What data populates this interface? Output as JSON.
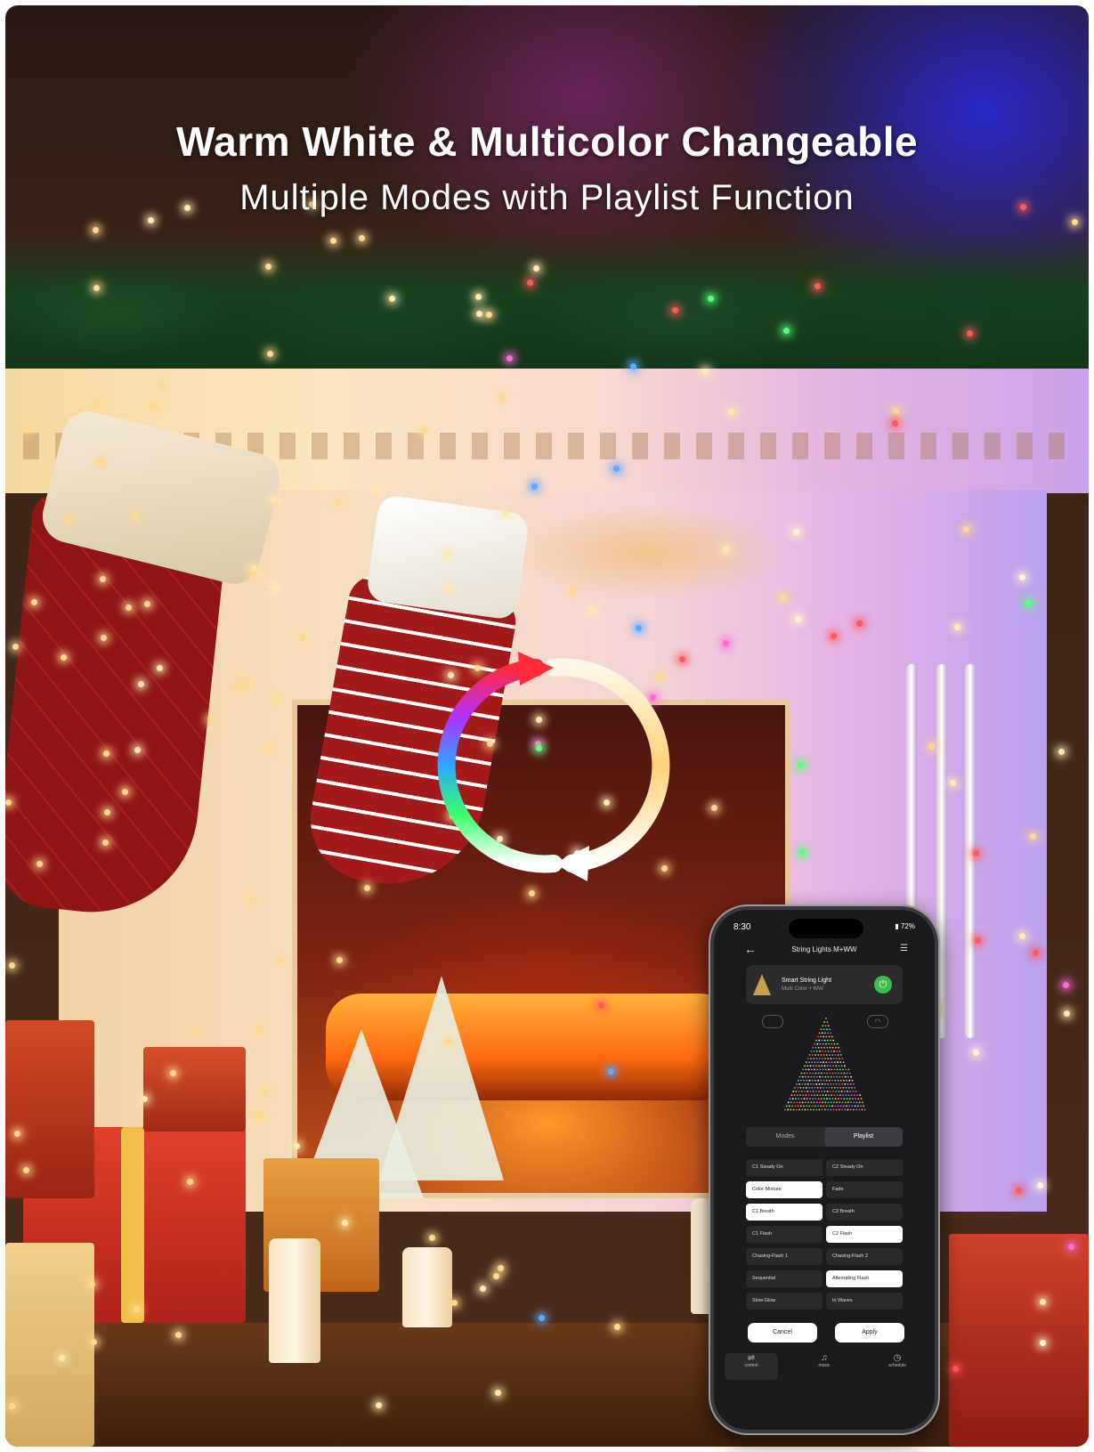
{
  "headline": "Warm White & Multicolor Changeable",
  "subheadline": "Multiple Modes with Playlist Function",
  "phone": {
    "status_time": "8:30",
    "battery": "72%",
    "nav_title": "String Lights M+WW",
    "device": {
      "name": "Smart String Light",
      "subtitle": "Multi Color + WW"
    },
    "tabs": [
      "Modes",
      "Playlist"
    ],
    "active_tab": "Playlist",
    "modes": [
      {
        "label": "C1 Steady On",
        "selected": false
      },
      {
        "label": "C2 Steady On",
        "selected": false
      },
      {
        "label": "Color Mixture",
        "selected": true
      },
      {
        "label": "Fade",
        "selected": false
      },
      {
        "label": "C1 Breath",
        "selected": true
      },
      {
        "label": "C2 Breath",
        "selected": false
      },
      {
        "label": "C1 Flash",
        "selected": false
      },
      {
        "label": "C2 Flash",
        "selected": true
      },
      {
        "label": "Chasing-Flash 1",
        "selected": false
      },
      {
        "label": "Chasing-Flash 2",
        "selected": false
      },
      {
        "label": "Sequential",
        "selected": false
      },
      {
        "label": "Alternating Flash",
        "selected": true
      },
      {
        "label": "Slow-Glow",
        "selected": false
      },
      {
        "label": "In Waves",
        "selected": false
      }
    ],
    "cancel_label": "Cancel",
    "apply_label": "Apply",
    "bottom_nav": [
      {
        "label": "control",
        "icon": "sliders-icon"
      },
      {
        "label": "music",
        "icon": "music-icon"
      },
      {
        "label": "schedule",
        "icon": "clock-icon"
      }
    ]
  },
  "colors": {
    "power_green": "#3bbf4a",
    "screen_bg": "#1b1b1d"
  }
}
